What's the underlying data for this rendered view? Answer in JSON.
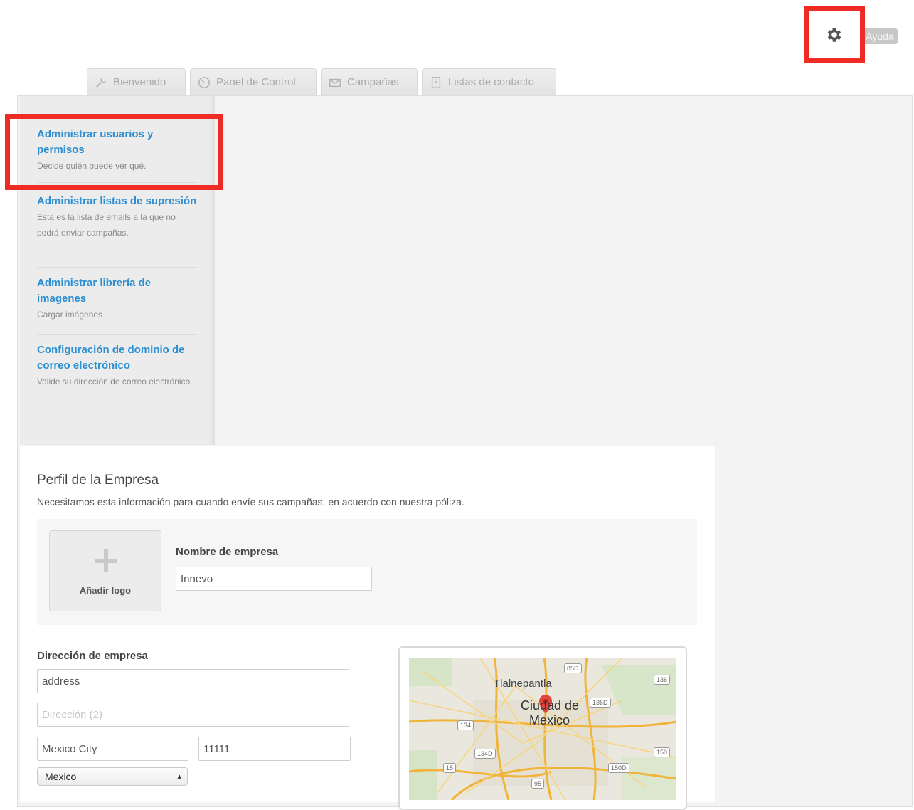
{
  "header": {
    "help_label": "Ayuda",
    "gear_icon": "gear-icon"
  },
  "highlight_color": "#ef2b24",
  "link_color": "#2b8ed1",
  "tabs": [
    {
      "label": "Bienvenido",
      "icon": "wrench-icon"
    },
    {
      "label": "Panel de Control",
      "icon": "gauge-icon"
    },
    {
      "label": "Campañas",
      "icon": "envelope-icon"
    },
    {
      "label": "Listas de contacto",
      "icon": "contact-book-icon"
    }
  ],
  "sidebar": {
    "items": [
      {
        "title": "Administrar usuarios y permisos",
        "desc": "Decide quién puede ver qué."
      },
      {
        "title": "Administrar listas de supresión",
        "desc": "Esta es la lista de emails a la que no podrá enviar campañas."
      },
      {
        "title": "Administrar librería de imagenes",
        "desc": "Cargar imágenes"
      },
      {
        "title": "Configuración de dominio de correo electrónico",
        "desc": "Valide su dirección de correo electrónico"
      }
    ]
  },
  "profile": {
    "title": "Perfil de la Empresa",
    "subtitle": "Necesitamos esta información para cuando envíe sus campañas, en acuerdo con nuestra póliza.",
    "logo_label": "Añadir logo",
    "company_name_label": "Nombre de empresa",
    "company_name_value": "Innevo",
    "address_label": "Dirección de empresa",
    "address_value": "address",
    "address2_placeholder": "Dirección (2)",
    "city_value": "Mexico City",
    "zip_value": "11111",
    "country_value": "Mexico"
  },
  "map": {
    "labels": [
      "Tlalnepantla",
      "Ciudad de",
      "Mexico"
    ],
    "shields": [
      "85D",
      "136",
      "136D",
      "134",
      "134D",
      "15",
      "150D",
      "150",
      "95"
    ]
  }
}
